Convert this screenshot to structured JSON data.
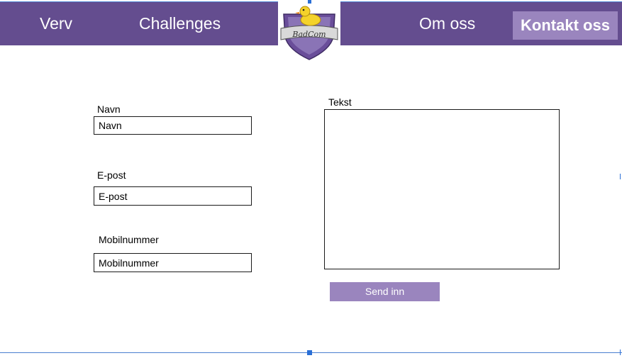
{
  "nav": {
    "items": [
      {
        "label": "Verv"
      },
      {
        "label": "Challenges"
      },
      {
        "label": "Om oss"
      }
    ],
    "active_label": "Kontakt oss",
    "logo_text": "BadCom"
  },
  "form": {
    "name": {
      "label": "Navn",
      "placeholder": "Navn"
    },
    "email": {
      "label": "E-post",
      "placeholder": "E-post"
    },
    "phone": {
      "label": "Mobilnummer",
      "placeholder": "Mobilnummer"
    },
    "text": {
      "label": "Tekst",
      "placeholder": ""
    },
    "submit_label": "Send inn"
  },
  "colors": {
    "nav_bg": "#644d8f",
    "accent": "#9a85be",
    "selection": "#2a6fd6"
  }
}
